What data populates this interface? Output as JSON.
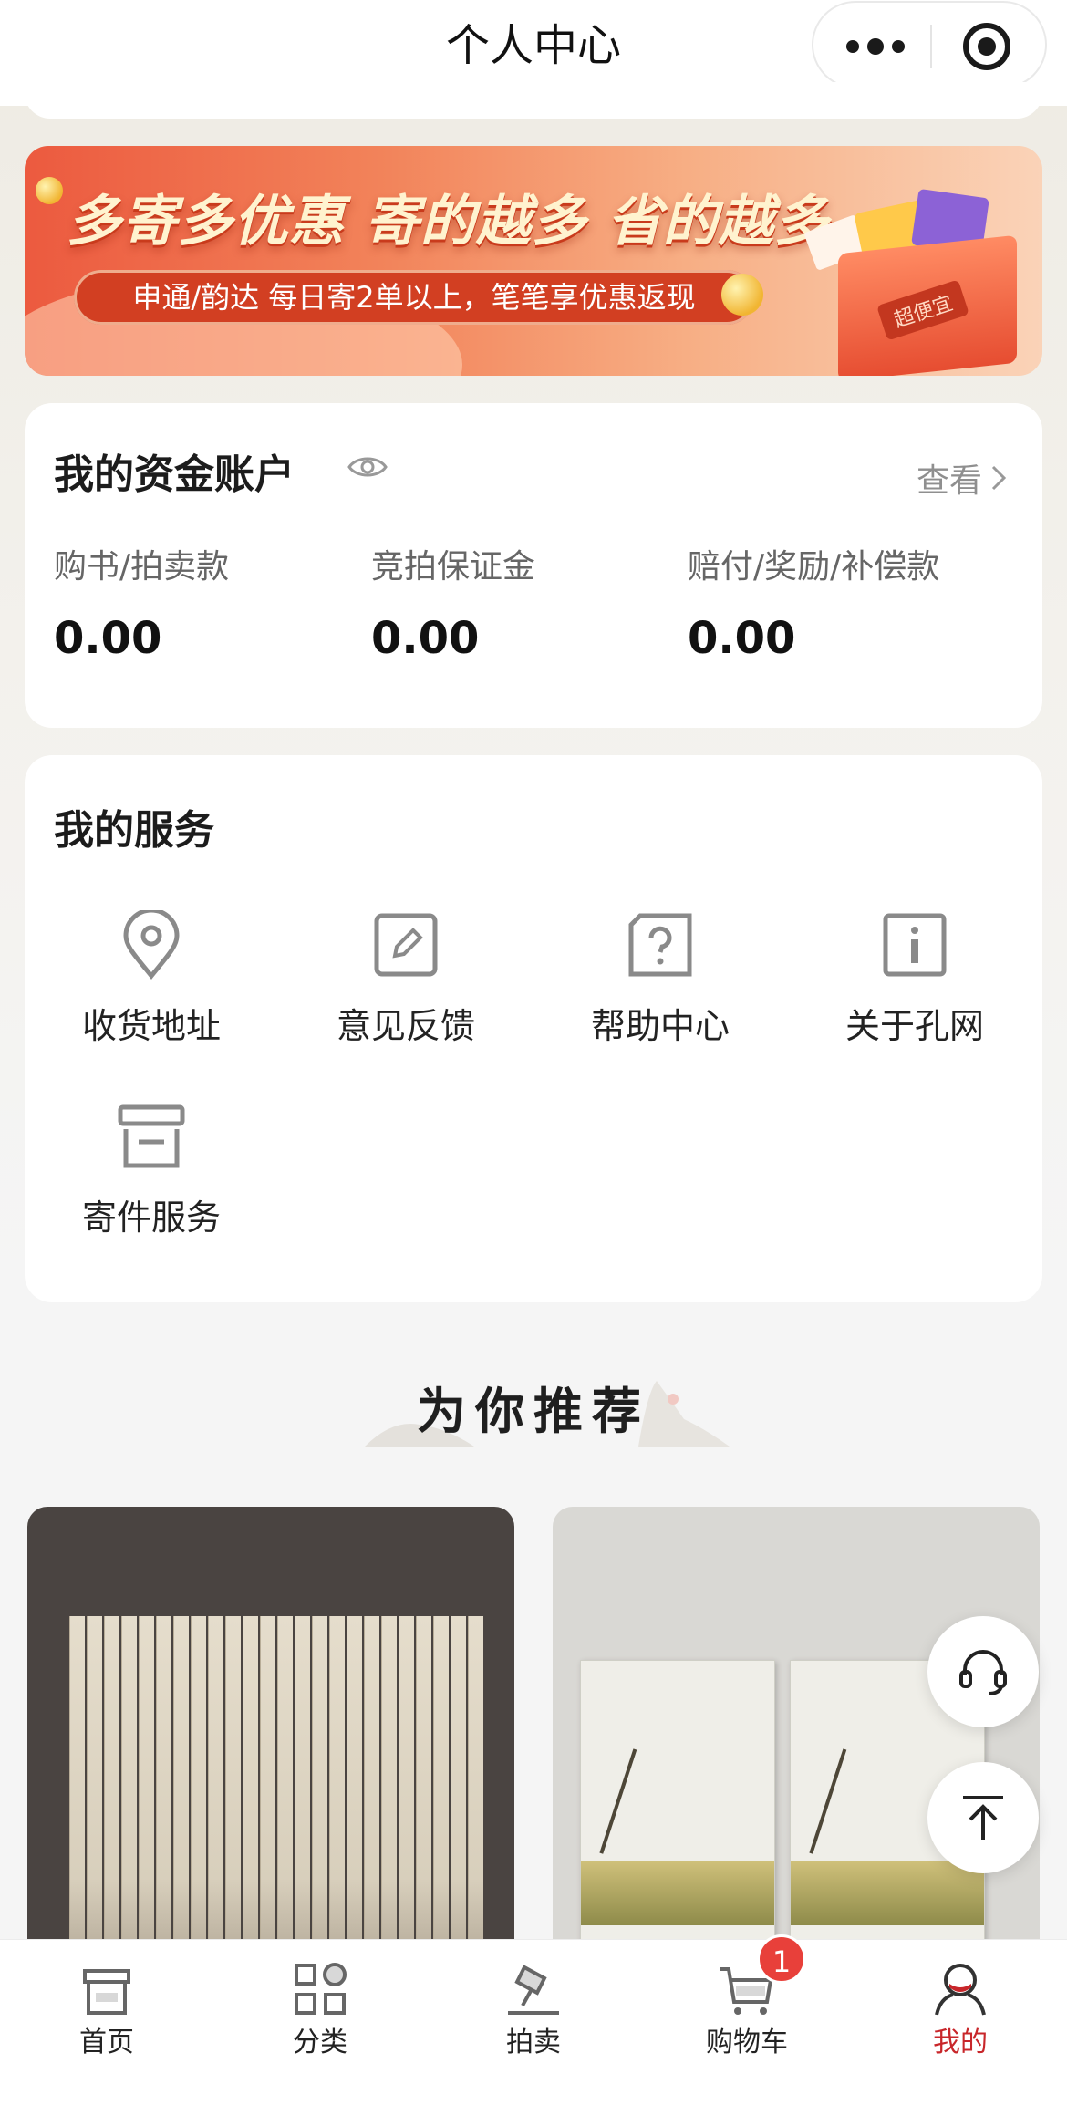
{
  "navbar": {
    "title": "个人中心",
    "more_icon": "more-dots-icon",
    "close_icon": "target-circle-icon"
  },
  "banner": {
    "headline": "多寄多优惠  寄的越多 省的越多",
    "subtitle": "申通/韵达 每日寄2单以上，笔笔享优惠返现",
    "box_label": "超便宜"
  },
  "account": {
    "title": "我的资金账户",
    "eye_icon": "eye-icon",
    "view_label": "查看",
    "funds": [
      {
        "label": "购书/拍卖款",
        "value": "0.00"
      },
      {
        "label": "竞拍保证金",
        "value": "0.00"
      },
      {
        "label": "赔付/奖励/补偿款",
        "value": "0.00"
      }
    ]
  },
  "services": {
    "title": "我的服务",
    "items": [
      {
        "label": "收货地址",
        "icon": "location-pin-icon"
      },
      {
        "label": "意见反馈",
        "icon": "edit-icon"
      },
      {
        "label": "帮助中心",
        "icon": "help-icon"
      },
      {
        "label": "关于孔网",
        "icon": "info-icon"
      },
      {
        "label": "寄件服务",
        "icon": "archive-box-icon"
      }
    ]
  },
  "recommend": {
    "title": "为你推荐"
  },
  "floating": {
    "service_icon": "headset-icon",
    "top_icon": "back-to-top-icon"
  },
  "tabbar": {
    "items": [
      {
        "label": "首页",
        "icon": "home-icon"
      },
      {
        "label": "分类",
        "icon": "category-icon"
      },
      {
        "label": "拍卖",
        "icon": "auction-hammer-icon"
      },
      {
        "label": "购物车",
        "icon": "cart-icon"
      },
      {
        "label": "我的",
        "icon": "profile-icon"
      }
    ],
    "active_index": 4,
    "cart_badge": "1",
    "active_color": "#c8262a"
  }
}
